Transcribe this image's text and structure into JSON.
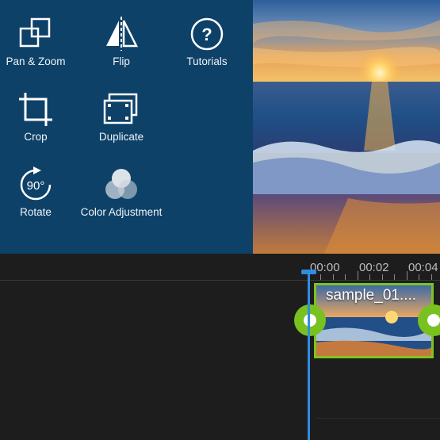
{
  "tools": [
    {
      "id": "pan-zoom",
      "label": "Pan & Zoom",
      "icon": "pan-zoom-icon"
    },
    {
      "id": "flip",
      "label": "Flip",
      "icon": "flip-icon"
    },
    {
      "id": "tutorials",
      "label": "Tutorials",
      "icon": "help-icon"
    },
    {
      "id": "crop",
      "label": "Crop",
      "icon": "crop-icon"
    },
    {
      "id": "duplicate",
      "label": "Duplicate",
      "icon": "duplicate-icon"
    },
    {
      "id": "rotate",
      "label": "Rotate",
      "icon": "rotate-90-icon",
      "icon_text": "90°"
    },
    {
      "id": "color-adjustment",
      "label": "Color Adjustment",
      "icon": "color-adjustment-icon"
    }
  ],
  "timeline": {
    "times": [
      "00:00",
      "00:02",
      "00:04"
    ],
    "clip_name": "sample_01...."
  },
  "colors": {
    "panel": "#0e4168",
    "accent_green": "#7ec320",
    "playhead_blue": "#2f8de0"
  }
}
